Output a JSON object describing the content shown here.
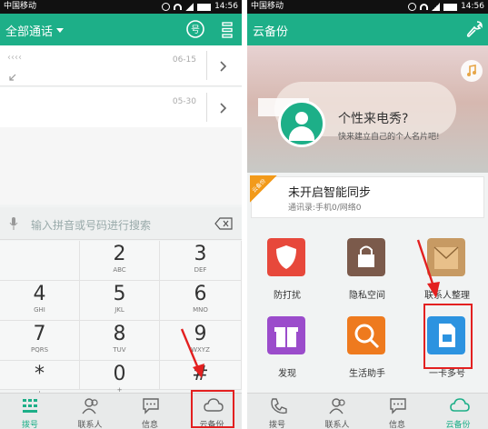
{
  "left": {
    "status": {
      "carrier": "中国移动",
      "time": "14:56"
    },
    "header": {
      "title": "全部通话"
    },
    "call_log": [
      {
        "number": "‹‹‹‹",
        "date": "06-15"
      },
      {
        "number": "",
        "date": "05-30"
      }
    ],
    "dial": {
      "placeholder": "输入拼音或号码进行搜索"
    },
    "keys": [
      {
        "digit": "",
        "letters": ""
      },
      {
        "digit": "2",
        "letters": "ABC"
      },
      {
        "digit": "3",
        "letters": "DEF"
      },
      {
        "digit": "4",
        "letters": "GHI"
      },
      {
        "digit": "5",
        "letters": "JKL"
      },
      {
        "digit": "6",
        "letters": "MNO"
      },
      {
        "digit": "7",
        "letters": "PQRS"
      },
      {
        "digit": "8",
        "letters": "TUV"
      },
      {
        "digit": "9",
        "letters": "WXYZ"
      },
      {
        "digit": "*",
        "letters": ","
      },
      {
        "digit": "0",
        "letters": "+"
      },
      {
        "digit": "#",
        "letters": ""
      }
    ],
    "tabs": [
      {
        "label": "拨号",
        "icon": "dialpad-icon"
      },
      {
        "label": "联系人",
        "icon": "contacts-icon"
      },
      {
        "label": "信息",
        "icon": "message-icon"
      },
      {
        "label": "云备份",
        "icon": "cloud-icon"
      }
    ]
  },
  "right": {
    "status": {
      "carrier": "中国移动",
      "time": "14:56"
    },
    "header": {
      "title": "云备份"
    },
    "banner": {
      "question": "个性来电秀?",
      "sub": "快来建立自己的个人名片吧!"
    },
    "sync": {
      "badge": "云备份",
      "title": "未开启智能同步",
      "detail": "通讯录:手机0/网络0"
    },
    "grid": [
      {
        "label": "防打扰",
        "color": "#e7483b"
      },
      {
        "label": "隐私空间",
        "color": "#7b5a4b"
      },
      {
        "label": "联系人整理",
        "color": "#c79a63"
      },
      {
        "label": "发现",
        "color": "#9b4ccb"
      },
      {
        "label": "生活助手",
        "color": "#ee7a1e"
      },
      {
        "label": "一卡多号",
        "color": "#2c93e0"
      }
    ],
    "tabs": [
      {
        "label": "拨号",
        "icon": "phone-icon"
      },
      {
        "label": "联系人",
        "icon": "contacts-icon"
      },
      {
        "label": "信息",
        "icon": "message-icon"
      },
      {
        "label": "云备份",
        "icon": "cloud-icon"
      }
    ]
  },
  "colors": {
    "accent": "#1daf88",
    "highlight": "#e32020"
  }
}
